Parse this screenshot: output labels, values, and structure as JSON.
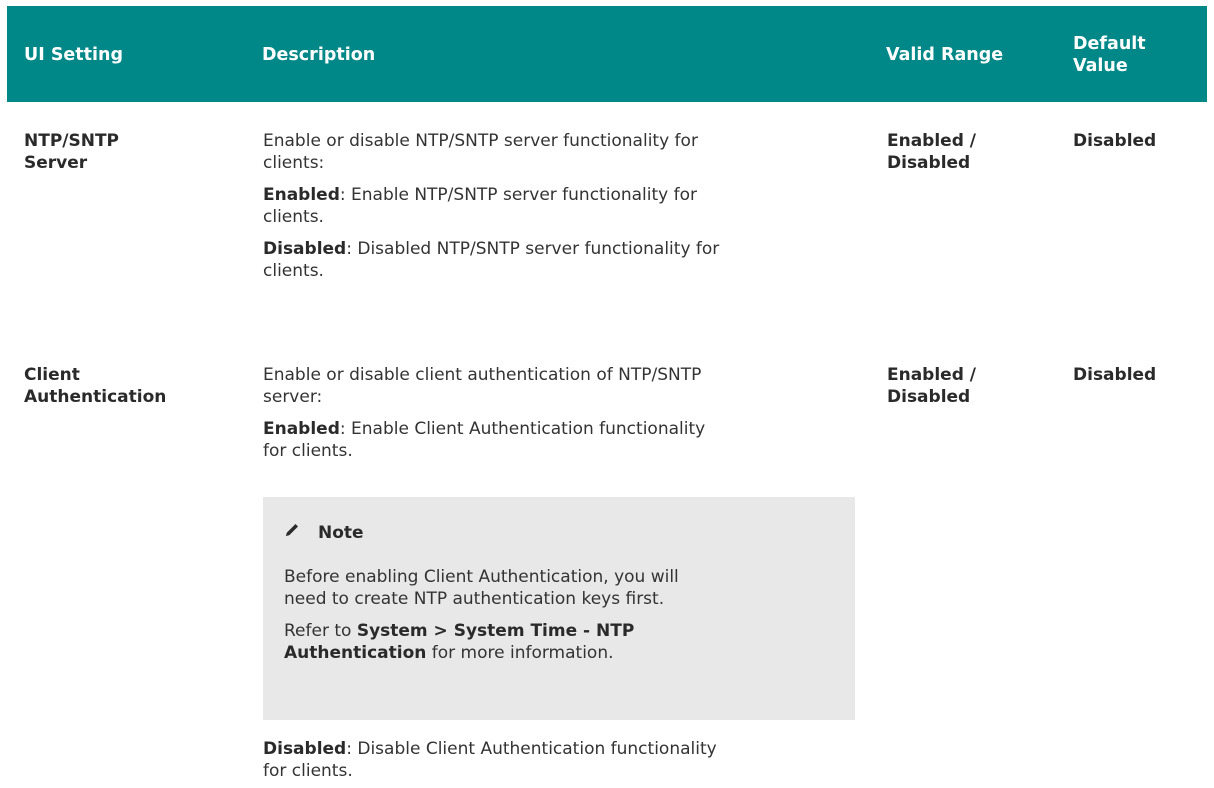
{
  "table": {
    "headers": {
      "ui_setting": "UI Setting",
      "description": "Description",
      "valid_range": "Valid Range",
      "default_value_line1": "Default",
      "default_value_line2": "Value"
    },
    "rows": [
      {
        "setting_line1": "NTP/SNTP",
        "setting_line2": "Server",
        "desc_intro_1": "Enable or disable NTP/SNTP server functionality for",
        "desc_intro_2": "clients:",
        "opt1_label": "Enabled",
        "opt1_text_1": ": Enable NTP/SNTP server functionality for",
        "opt1_text_2": "clients.",
        "opt2_label": "Disabled",
        "opt2_text_1": ": Disabled NTP/SNTP server functionality for",
        "opt2_text_2": "clients.",
        "range_line1": "Enabled /",
        "range_line2": "Disabled",
        "default": "Disabled"
      },
      {
        "setting_line1": "Client",
        "setting_line2": "Authentication",
        "desc_intro_1": "Enable or disable client authentication of NTP/SNTP",
        "desc_intro_2": "server:",
        "opt1_label": "Enabled",
        "opt1_text_1": ": Enable Client Authentication functionality",
        "opt1_text_2": "for clients.",
        "note": {
          "icon": "pencil-icon",
          "title": "Note",
          "line1": "Before enabling Client Authentication, you will",
          "line2": "need to create NTP authentication keys first.",
          "ref_prefix": "Refer to ",
          "ref_bold_1": "System > System Time - NTP",
          "ref_bold_2": "Authentication",
          "ref_suffix": " for more information."
        },
        "opt2_label": "Disabled",
        "opt2_text_1": ": Disable Client Authentication functionality",
        "opt2_text_2": "for clients.",
        "range_line1": "Enabled /",
        "range_line2": "Disabled",
        "default": "Disabled"
      }
    ]
  },
  "colors": {
    "header_bg": "#008787",
    "note_bg": "#e8e8e8"
  }
}
